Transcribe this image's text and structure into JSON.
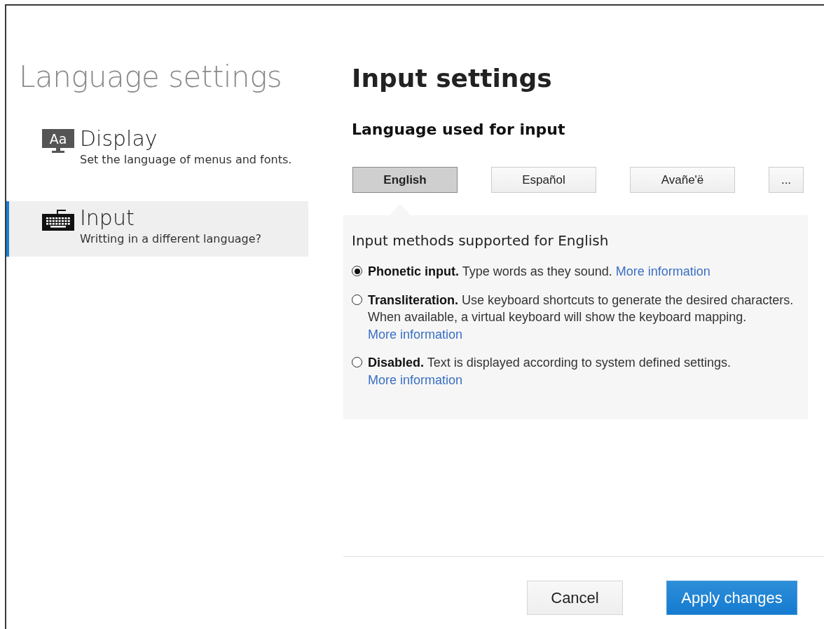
{
  "sidebar": {
    "title": "Language settings",
    "items": [
      {
        "kind": "monitor",
        "icon_label": "Aa",
        "label": "Display",
        "description": "Set the language of menus and fonts.",
        "selected": false
      },
      {
        "kind": "keyboard",
        "label": "Input",
        "description": "Writting in a different language?",
        "selected": true
      }
    ]
  },
  "main": {
    "title": "Input settings",
    "section_title": "Language used for input",
    "languages": [
      {
        "label": "English",
        "selected": true
      },
      {
        "label": "Español",
        "selected": false
      },
      {
        "label": "Avañe'ë",
        "selected": false
      },
      {
        "label": "...",
        "selected": false
      }
    ],
    "panel_title": "Input methods supported for English",
    "options": [
      {
        "title": "Phonetic input.",
        "description": "Type words as they sound.",
        "link": "More information",
        "selected": true
      },
      {
        "title": "Transliteration.",
        "description": "Use keyboard shortcuts to generate the desired characters. When available, a virtual keyboard will show the keyboard mapping.",
        "link": "More information",
        "selected": false
      },
      {
        "title": "Disabled.",
        "description": "Text is displayed according to system defined settings.",
        "link": "More information",
        "selected": false
      }
    ],
    "buttons": [
      {
        "kind": "secondary",
        "label": "Cancel"
      },
      {
        "kind": "primary",
        "label": "Apply changes"
      }
    ]
  }
}
